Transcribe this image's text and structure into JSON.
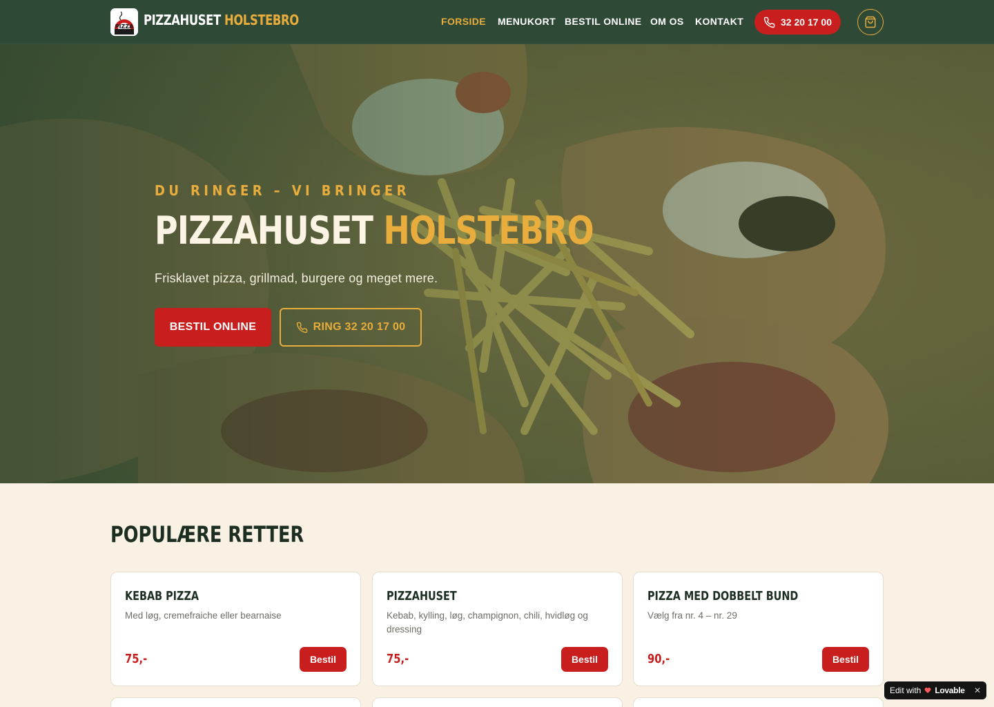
{
  "brand": {
    "name_white": "PIZZAHUSET",
    "name_gold": "HOLSTEBRO",
    "logo_text": "PIZZA"
  },
  "nav": {
    "items": [
      {
        "label": "FORSIDE",
        "active": true
      },
      {
        "label": "MENUKORT",
        "active": false
      },
      {
        "label": "BESTIL ONLINE",
        "active": false
      },
      {
        "label": "OM OS",
        "active": false
      },
      {
        "label": "KONTAKT",
        "active": false
      }
    ],
    "phone": "32 20 17 00",
    "cart_icon": "shopping-bag-icon"
  },
  "hero": {
    "tagline": "DU RINGER – VI BRINGER",
    "title_white": "PIZZAHUSET",
    "title_gold": "HOLSTEBRO",
    "subtitle": "Frisklavet pizza, grillmad, burgere og meget mere.",
    "order_button": "BESTIL ONLINE",
    "call_button": "RING 32 20 17 00"
  },
  "popular": {
    "title": "POPULÆRE RETTER",
    "items": [
      {
        "name": "KEBAB PIZZA",
        "description": "Med løg, cremefraiche eller bearnaise",
        "price": "75,-",
        "button": "Bestil"
      },
      {
        "name": "PIZZAHUSET",
        "description": "Kebab, kylling, løg, champignon, chili, hvidløg og dressing",
        "price": "75,-",
        "button": "Bestil"
      },
      {
        "name": "PIZZA MED DOBBELT BUND",
        "description": "Vælg fra nr. 4 – nr. 29",
        "price": "90,-",
        "button": "Bestil"
      }
    ]
  },
  "badge": {
    "prefix": "Edit with",
    "name": "Lovable",
    "close": "✕"
  },
  "colors": {
    "nav_bg": "#2e4a37",
    "accent_gold": "#e8ad3c",
    "accent_red": "#c81e1e",
    "page_bg": "#f8f1e4"
  }
}
